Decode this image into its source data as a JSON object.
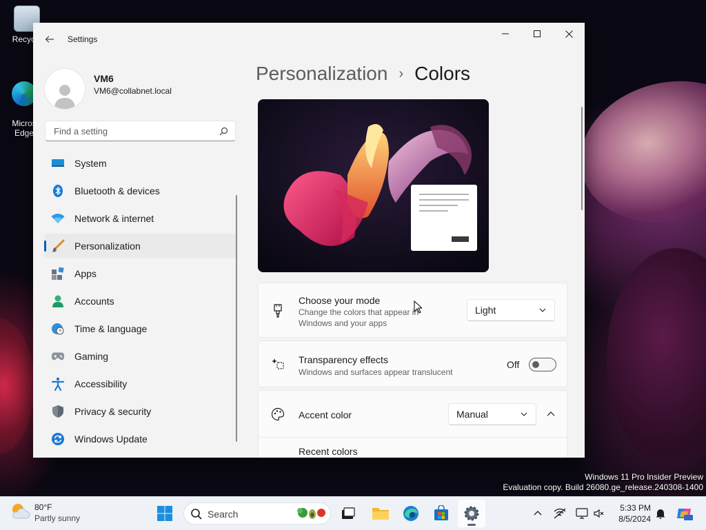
{
  "desktop": {
    "icons": [
      {
        "label": "Recycle"
      },
      {
        "label": "Micros\nEdge"
      }
    ],
    "watermark": {
      "line1": "Windows 11 Pro Insider Preview",
      "line2": "Evaluation copy. Build 26080.ge_release.240308-1400"
    }
  },
  "window": {
    "title": "Settings",
    "caption": {
      "minimize": "minimize",
      "maximize": "maximize",
      "close": "close"
    }
  },
  "profile": {
    "name": "VM6",
    "email": "VM6@collabnet.local"
  },
  "search": {
    "placeholder": "Find a setting"
  },
  "nav": {
    "items": [
      {
        "label": "System",
        "icon": "system-icon"
      },
      {
        "label": "Bluetooth & devices",
        "icon": "bluetooth-icon"
      },
      {
        "label": "Network & internet",
        "icon": "wifi-icon"
      },
      {
        "label": "Personalization",
        "icon": "brush-icon",
        "active": true
      },
      {
        "label": "Apps",
        "icon": "apps-icon"
      },
      {
        "label": "Accounts",
        "icon": "accounts-icon"
      },
      {
        "label": "Time & language",
        "icon": "globe-clock-icon"
      },
      {
        "label": "Gaming",
        "icon": "gamepad-icon"
      },
      {
        "label": "Accessibility",
        "icon": "accessibility-icon"
      },
      {
        "label": "Privacy & security",
        "icon": "shield-icon"
      },
      {
        "label": "Windows Update",
        "icon": "update-icon"
      }
    ]
  },
  "breadcrumb": {
    "parent": "Personalization",
    "separator": "›",
    "current": "Colors"
  },
  "mode_card": {
    "title": "Choose your mode",
    "description": "Change the colors that appear in Windows and your apps",
    "value": "Light"
  },
  "transparency_card": {
    "title": "Transparency effects",
    "description": "Windows and surfaces appear translucent",
    "state_label": "Off"
  },
  "accent_card": {
    "title": "Accent color",
    "value": "Manual",
    "subheading": "Recent colors"
  },
  "taskbar": {
    "weather": {
      "temp": "80°F",
      "condition": "Partly sunny"
    },
    "search_label": "Search",
    "clock": {
      "time": "5:33 PM",
      "date": "8/5/2024"
    }
  },
  "colors": {
    "accent": "#005fb8",
    "window_bg": "#f3f3f3",
    "card_bg": "#fbfbfb",
    "taskbar_bg": "#eef1f6"
  }
}
